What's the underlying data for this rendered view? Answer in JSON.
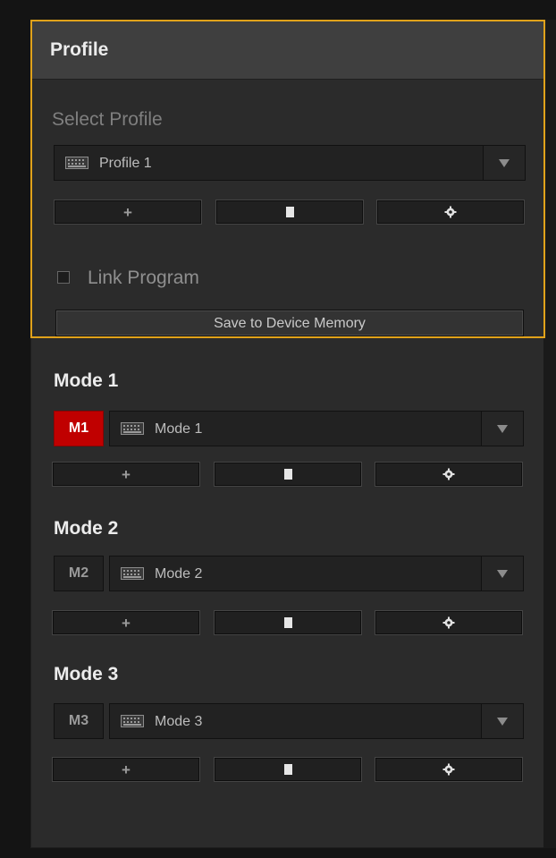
{
  "profile": {
    "header": "Profile",
    "select_label": "Select Profile",
    "selected": "Profile 1",
    "actions": [
      "+",
      "delete",
      "settings"
    ],
    "link_program_label": "Link Program",
    "link_program_checked": false,
    "save_button": "Save to Device Memory",
    "accent_color": "#e0a21a"
  },
  "modes": [
    {
      "title": "Mode 1",
      "badge": "M1",
      "selected": "Mode 1",
      "active": true,
      "badge_color": "#c00000"
    },
    {
      "title": "Mode 2",
      "badge": "M2",
      "selected": "Mode 2",
      "active": false
    },
    {
      "title": "Mode 3",
      "badge": "M3",
      "selected": "Mode 3",
      "active": false
    }
  ]
}
